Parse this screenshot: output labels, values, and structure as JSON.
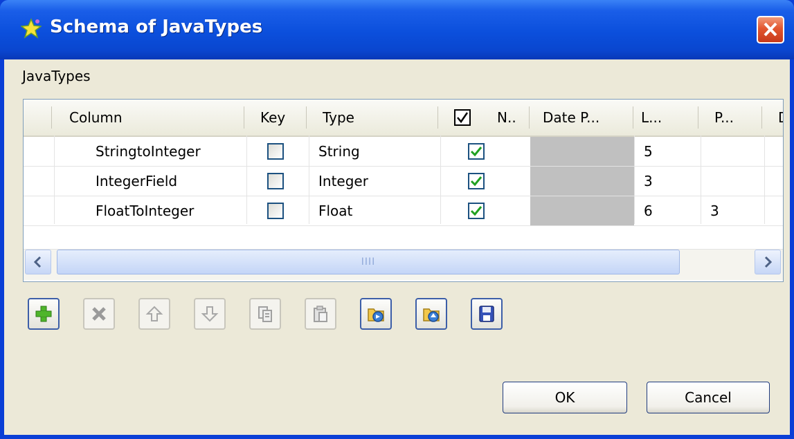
{
  "window": {
    "title": "Schema of JavaTypes",
    "close_icon": "close-icon"
  },
  "group_label": "JavaTypes",
  "table": {
    "columns": [
      "Column",
      "Key",
      "Type",
      "N..",
      "Date P...",
      "L...",
      "P...",
      "D"
    ],
    "rows": [
      {
        "column": "StringtoInteger",
        "key": false,
        "type": "String",
        "nullable": true,
        "date_pattern": "",
        "length": "5",
        "precision": ""
      },
      {
        "column": "IntegerField",
        "key": false,
        "type": "Integer",
        "nullable": true,
        "date_pattern": "",
        "length": "3",
        "precision": ""
      },
      {
        "column": "FloatToInteger",
        "key": false,
        "type": "Float",
        "nullable": true,
        "date_pattern": "",
        "length": "6",
        "precision": "3"
      }
    ],
    "scrollbar": {
      "left_icon": "chevron-left-icon",
      "right_icon": "chevron-right-icon",
      "grip": "IIII"
    }
  },
  "toolbar": [
    {
      "name": "add-button",
      "icon": "plus-icon",
      "enabled": true
    },
    {
      "name": "delete-button",
      "icon": "x-icon",
      "enabled": false
    },
    {
      "name": "move-up-button",
      "icon": "arrow-up-icon",
      "enabled": false
    },
    {
      "name": "move-down-button",
      "icon": "arrow-down-icon",
      "enabled": false
    },
    {
      "name": "copy-button",
      "icon": "copy-icon",
      "enabled": false
    },
    {
      "name": "paste-button",
      "icon": "paste-icon",
      "enabled": false
    },
    {
      "name": "import-button",
      "icon": "import-icon",
      "enabled": true
    },
    {
      "name": "export-button",
      "icon": "export-icon",
      "enabled": true
    },
    {
      "name": "save-button",
      "icon": "save-icon",
      "enabled": true
    }
  ],
  "buttons": {
    "ok": "OK",
    "cancel": "Cancel"
  },
  "colors": {
    "titlebar": "#0a46cf",
    "client": "#ece9d8",
    "check": "#21a121",
    "close": "#e2562f"
  }
}
